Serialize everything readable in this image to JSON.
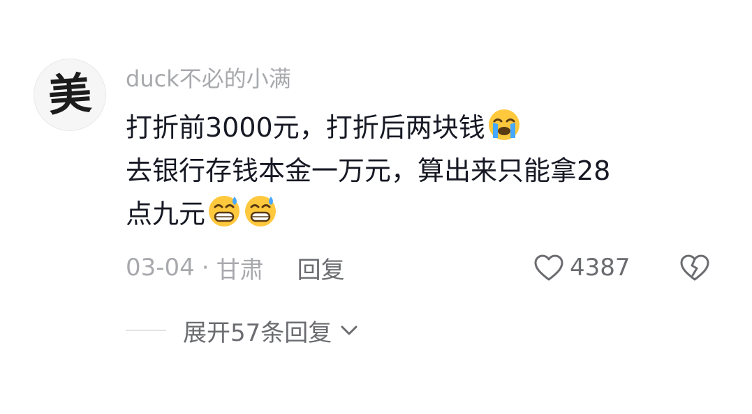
{
  "comment": {
    "avatar_text": "美",
    "username": "duck不必的小满",
    "lines": [
      "打折前3000元，打折后两块钱",
      "去银行存钱本金一万元，算出来只能拿28",
      "点九元"
    ],
    "emoji_line1": "loudly-crying-face",
    "emoji_line3": [
      "grinning-face-with-sweat",
      "grinning-face-with-sweat"
    ],
    "date": "03-04",
    "separator": "·",
    "location": "甘肃",
    "reply_label": "回复",
    "like_count": "4387",
    "expand_label": "展开57条回复"
  },
  "colors": {
    "text": "#161823",
    "muted": "#a8a9ad",
    "secondary": "#6b6c70",
    "emoji_face": "#ffc83d",
    "tear": "#46a8ff"
  }
}
